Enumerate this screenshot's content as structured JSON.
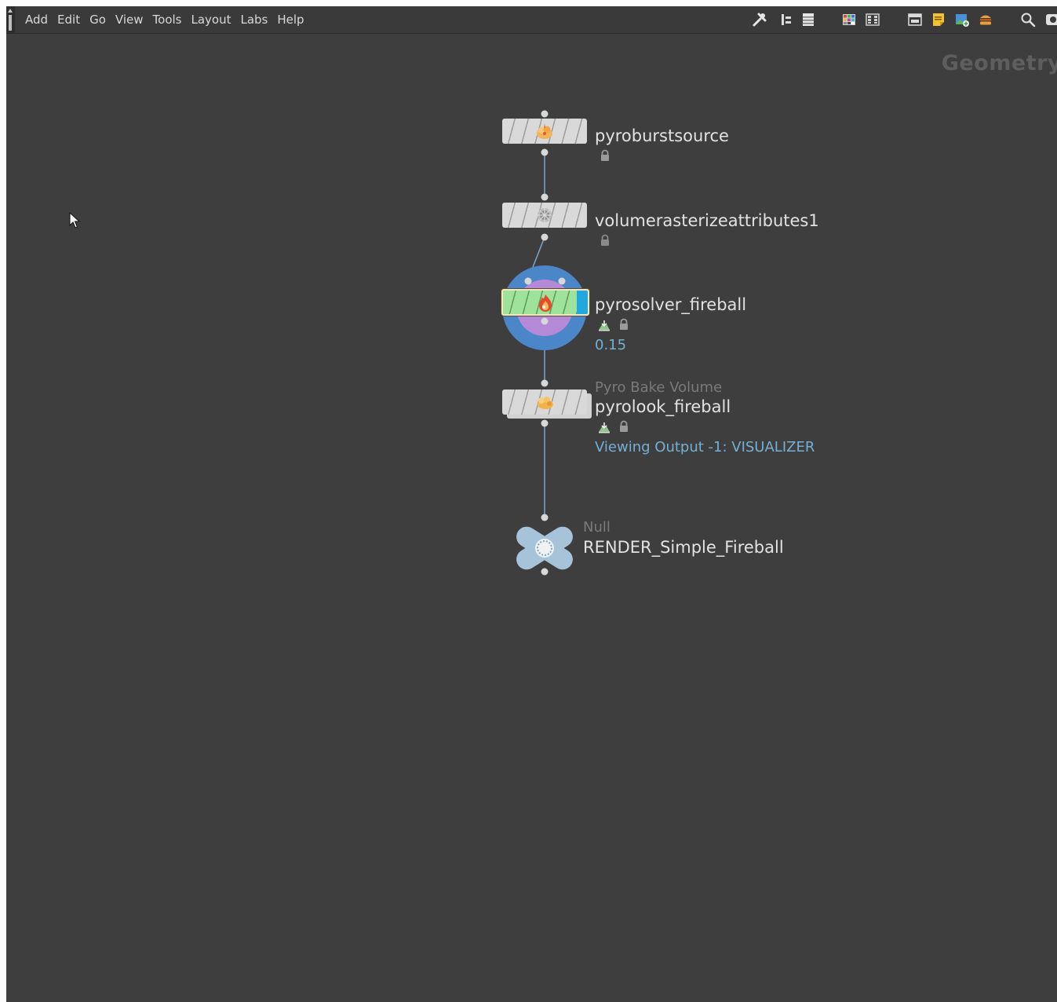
{
  "menu": {
    "items": [
      "Add",
      "Edit",
      "Go",
      "View",
      "Tools",
      "Layout",
      "Labs",
      "Help"
    ]
  },
  "toolbar": {
    "icons": [
      "wrench-icon",
      "tree-view-icon",
      "list-view-icon",
      "color-palette-icon",
      "grid-view-icon",
      "network-box-icon",
      "sticky-note-icon",
      "background-image-icon",
      "hamburger-menu-icon",
      "search-icon",
      "eye-icon"
    ]
  },
  "network": {
    "context_label": "Geometry",
    "nodes": [
      {
        "id": "pyroburstsource",
        "name": "pyroburstsource",
        "type_label": "",
        "note": "",
        "icon": "burst-source-icon",
        "flags": [
          "lock-icon"
        ]
      },
      {
        "id": "volumerasterizeattributes1",
        "name": "volumerasterizeattributes1",
        "type_label": "",
        "note": "",
        "icon": "rasterize-icon",
        "flags": [
          "lock-icon"
        ]
      },
      {
        "id": "pyrosolver_fireball",
        "name": "pyrosolver_fireball",
        "type_label": "",
        "note": "0.15",
        "icon": "fire-icon",
        "flags": [
          "display-flag-icon",
          "lock-icon"
        ],
        "selected": true
      },
      {
        "id": "pyrolook_fireball",
        "name": "pyrolook_fireball",
        "type_label": "Pyro Bake Volume",
        "note": "Viewing Output -1: VISUALIZER",
        "icon": "smoke-icon",
        "flags": [
          "display-flag-icon",
          "lock-icon"
        ]
      },
      {
        "id": "render_null",
        "name": "RENDER_Simple_Fireball",
        "type_label": "Null",
        "note": "",
        "icon": "null-node-icon",
        "flags": []
      }
    ]
  },
  "colors": {
    "background": "#3e3e3e",
    "wire": "#7ea6c8",
    "note": "#74afd6",
    "solver_ring_outer": "#4a86c8",
    "solver_ring_inner": "#b48ad8",
    "selected_body": "#9ee29b",
    "display_flag": "#22a8e0",
    "null_node": "#a7c3d9"
  }
}
